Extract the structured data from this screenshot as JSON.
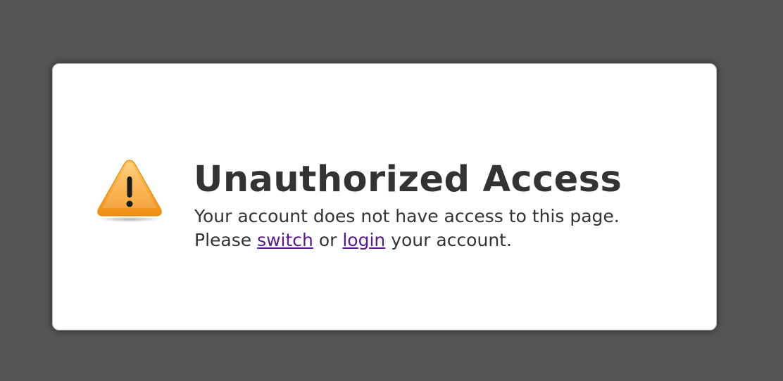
{
  "dialog": {
    "icon": "warning-triangle-icon",
    "accent_color": "#f5a020",
    "title": "Unauthorized Access",
    "line1": "Your account does not have access to this page.",
    "line2_prefix": "Please ",
    "switch_link": "switch",
    "between": " or ",
    "login_link": "login",
    "line2_suffix": " your account."
  }
}
